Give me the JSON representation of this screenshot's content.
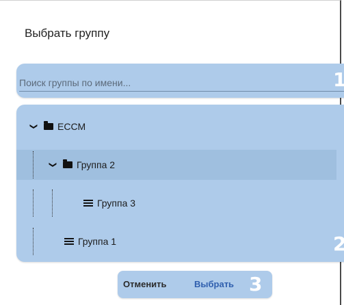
{
  "dialog": {
    "title": "Выбрать группу"
  },
  "search": {
    "placeholder": "Поиск группы по имени..."
  },
  "tree": {
    "nodes": [
      {
        "label": "ECCM",
        "type": "folder",
        "expanded": true
      },
      {
        "label": "Группа 2",
        "type": "folder",
        "expanded": true,
        "selected": true
      },
      {
        "label": "Группа 3",
        "type": "list"
      },
      {
        "label": "Группа 1",
        "type": "list"
      }
    ]
  },
  "actions": {
    "cancel_label": "Отменить",
    "select_label": "Выбрать"
  },
  "annotations": {
    "search_badge": "1",
    "tree_badge": "2",
    "actions_badge": "3"
  },
  "colors": {
    "highlight": "#aecbea",
    "selected_row": "#9fbfdf",
    "primary_text": "#2f5fae"
  },
  "icons": {
    "expand": "chevron-down-icon",
    "folder": "folder-icon",
    "group": "list-icon"
  }
}
